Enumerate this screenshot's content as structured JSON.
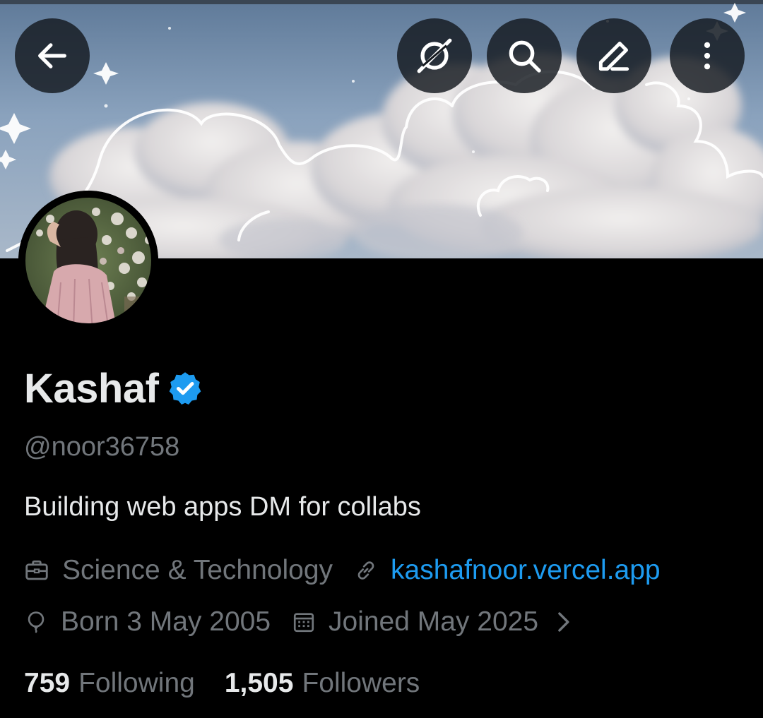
{
  "profile": {
    "display_name": "Kashaf",
    "handle": "@noor36758",
    "bio": "Building web apps DM for collabs",
    "category": "Science & Technology",
    "website": "kashafnoor.vercel.app",
    "birthday": "Born 3 May 2005",
    "joined": "Joined May 2025",
    "verified": true
  },
  "stats": {
    "following_count": "759",
    "following_label": "Following",
    "followers_count": "1,505",
    "followers_label": "Followers"
  },
  "top_actions": {
    "back_icon": "arrow-left-icon",
    "grok_icon": "grok-icon",
    "search_icon": "search-icon",
    "edit_icon": "pencil-icon",
    "more_icon": "more-vertical-icon"
  },
  "colors": {
    "background": "#000000",
    "primary_text": "#e7e9ea",
    "secondary_text": "#71767b",
    "link": "#1d9bf0",
    "verified_badge": "#1d9bf0",
    "banner_sky": "#7e97b4"
  }
}
